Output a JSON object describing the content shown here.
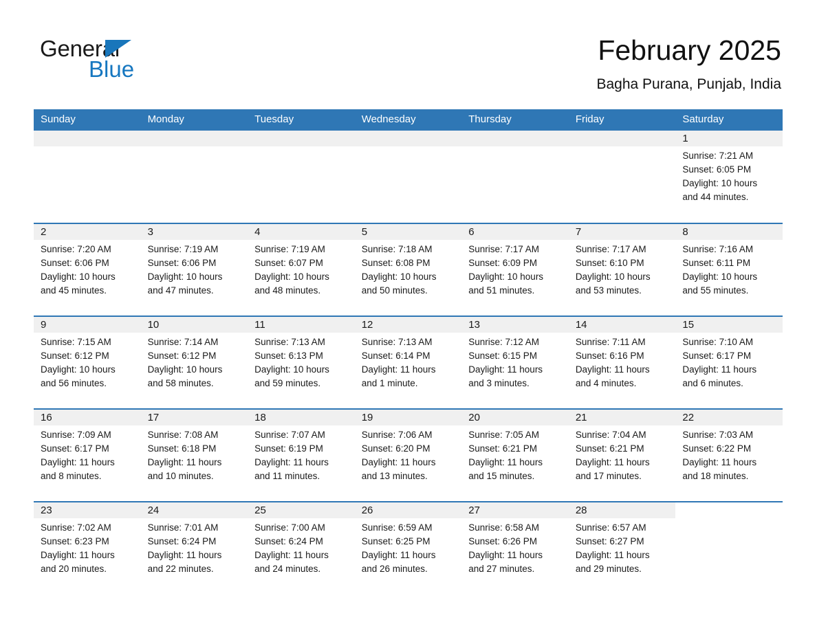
{
  "brand": {
    "name_top": "General",
    "name_bottom": "Blue",
    "triangle_color": "#1976bb",
    "blue_text_color": "#1677c0"
  },
  "header": {
    "title": "February 2025",
    "subtitle": "Bagha Purana, Punjab, India"
  },
  "theme": {
    "header_blue": "#2f77b5",
    "daynum_band": "#f0f0f0",
    "text": "#1a1a1a"
  },
  "weekdays": [
    "Sunday",
    "Monday",
    "Tuesday",
    "Wednesday",
    "Thursday",
    "Friday",
    "Saturday"
  ],
  "weeks": [
    [
      {
        "day": "",
        "empty": true
      },
      {
        "day": "",
        "empty": true
      },
      {
        "day": "",
        "empty": true
      },
      {
        "day": "",
        "empty": true
      },
      {
        "day": "",
        "empty": true
      },
      {
        "day": "",
        "empty": true
      },
      {
        "day": "1",
        "sunrise": "Sunrise: 7:21 AM",
        "sunset": "Sunset: 6:05 PM",
        "daylight1": "Daylight: 10 hours",
        "daylight2": "and 44 minutes."
      }
    ],
    [
      {
        "day": "2",
        "sunrise": "Sunrise: 7:20 AM",
        "sunset": "Sunset: 6:06 PM",
        "daylight1": "Daylight: 10 hours",
        "daylight2": "and 45 minutes."
      },
      {
        "day": "3",
        "sunrise": "Sunrise: 7:19 AM",
        "sunset": "Sunset: 6:06 PM",
        "daylight1": "Daylight: 10 hours",
        "daylight2": "and 47 minutes."
      },
      {
        "day": "4",
        "sunrise": "Sunrise: 7:19 AM",
        "sunset": "Sunset: 6:07 PM",
        "daylight1": "Daylight: 10 hours",
        "daylight2": "and 48 minutes."
      },
      {
        "day": "5",
        "sunrise": "Sunrise: 7:18 AM",
        "sunset": "Sunset: 6:08 PM",
        "daylight1": "Daylight: 10 hours",
        "daylight2": "and 50 minutes."
      },
      {
        "day": "6",
        "sunrise": "Sunrise: 7:17 AM",
        "sunset": "Sunset: 6:09 PM",
        "daylight1": "Daylight: 10 hours",
        "daylight2": "and 51 minutes."
      },
      {
        "day": "7",
        "sunrise": "Sunrise: 7:17 AM",
        "sunset": "Sunset: 6:10 PM",
        "daylight1": "Daylight: 10 hours",
        "daylight2": "and 53 minutes."
      },
      {
        "day": "8",
        "sunrise": "Sunrise: 7:16 AM",
        "sunset": "Sunset: 6:11 PM",
        "daylight1": "Daylight: 10 hours",
        "daylight2": "and 55 minutes."
      }
    ],
    [
      {
        "day": "9",
        "sunrise": "Sunrise: 7:15 AM",
        "sunset": "Sunset: 6:12 PM",
        "daylight1": "Daylight: 10 hours",
        "daylight2": "and 56 minutes."
      },
      {
        "day": "10",
        "sunrise": "Sunrise: 7:14 AM",
        "sunset": "Sunset: 6:12 PM",
        "daylight1": "Daylight: 10 hours",
        "daylight2": "and 58 minutes."
      },
      {
        "day": "11",
        "sunrise": "Sunrise: 7:13 AM",
        "sunset": "Sunset: 6:13 PM",
        "daylight1": "Daylight: 10 hours",
        "daylight2": "and 59 minutes."
      },
      {
        "day": "12",
        "sunrise": "Sunrise: 7:13 AM",
        "sunset": "Sunset: 6:14 PM",
        "daylight1": "Daylight: 11 hours",
        "daylight2": "and 1 minute."
      },
      {
        "day": "13",
        "sunrise": "Sunrise: 7:12 AM",
        "sunset": "Sunset: 6:15 PM",
        "daylight1": "Daylight: 11 hours",
        "daylight2": "and 3 minutes."
      },
      {
        "day": "14",
        "sunrise": "Sunrise: 7:11 AM",
        "sunset": "Sunset: 6:16 PM",
        "daylight1": "Daylight: 11 hours",
        "daylight2": "and 4 minutes."
      },
      {
        "day": "15",
        "sunrise": "Sunrise: 7:10 AM",
        "sunset": "Sunset: 6:17 PM",
        "daylight1": "Daylight: 11 hours",
        "daylight2": "and 6 minutes."
      }
    ],
    [
      {
        "day": "16",
        "sunrise": "Sunrise: 7:09 AM",
        "sunset": "Sunset: 6:17 PM",
        "daylight1": "Daylight: 11 hours",
        "daylight2": "and 8 minutes."
      },
      {
        "day": "17",
        "sunrise": "Sunrise: 7:08 AM",
        "sunset": "Sunset: 6:18 PM",
        "daylight1": "Daylight: 11 hours",
        "daylight2": "and 10 minutes."
      },
      {
        "day": "18",
        "sunrise": "Sunrise: 7:07 AM",
        "sunset": "Sunset: 6:19 PM",
        "daylight1": "Daylight: 11 hours",
        "daylight2": "and 11 minutes."
      },
      {
        "day": "19",
        "sunrise": "Sunrise: 7:06 AM",
        "sunset": "Sunset: 6:20 PM",
        "daylight1": "Daylight: 11 hours",
        "daylight2": "and 13 minutes."
      },
      {
        "day": "20",
        "sunrise": "Sunrise: 7:05 AM",
        "sunset": "Sunset: 6:21 PM",
        "daylight1": "Daylight: 11 hours",
        "daylight2": "and 15 minutes."
      },
      {
        "day": "21",
        "sunrise": "Sunrise: 7:04 AM",
        "sunset": "Sunset: 6:21 PM",
        "daylight1": "Daylight: 11 hours",
        "daylight2": "and 17 minutes."
      },
      {
        "day": "22",
        "sunrise": "Sunrise: 7:03 AM",
        "sunset": "Sunset: 6:22 PM",
        "daylight1": "Daylight: 11 hours",
        "daylight2": "and 18 minutes."
      }
    ],
    [
      {
        "day": "23",
        "sunrise": "Sunrise: 7:02 AM",
        "sunset": "Sunset: 6:23 PM",
        "daylight1": "Daylight: 11 hours",
        "daylight2": "and 20 minutes."
      },
      {
        "day": "24",
        "sunrise": "Sunrise: 7:01 AM",
        "sunset": "Sunset: 6:24 PM",
        "daylight1": "Daylight: 11 hours",
        "daylight2": "and 22 minutes."
      },
      {
        "day": "25",
        "sunrise": "Sunrise: 7:00 AM",
        "sunset": "Sunset: 6:24 PM",
        "daylight1": "Daylight: 11 hours",
        "daylight2": "and 24 minutes."
      },
      {
        "day": "26",
        "sunrise": "Sunrise: 6:59 AM",
        "sunset": "Sunset: 6:25 PM",
        "daylight1": "Daylight: 11 hours",
        "daylight2": "and 26 minutes."
      },
      {
        "day": "27",
        "sunrise": "Sunrise: 6:58 AM",
        "sunset": "Sunset: 6:26 PM",
        "daylight1": "Daylight: 11 hours",
        "daylight2": "and 27 minutes."
      },
      {
        "day": "28",
        "sunrise": "Sunrise: 6:57 AM",
        "sunset": "Sunset: 6:27 PM",
        "daylight1": "Daylight: 11 hours",
        "daylight2": "and 29 minutes."
      },
      {
        "day": "",
        "empty": true,
        "blank": true
      }
    ]
  ]
}
